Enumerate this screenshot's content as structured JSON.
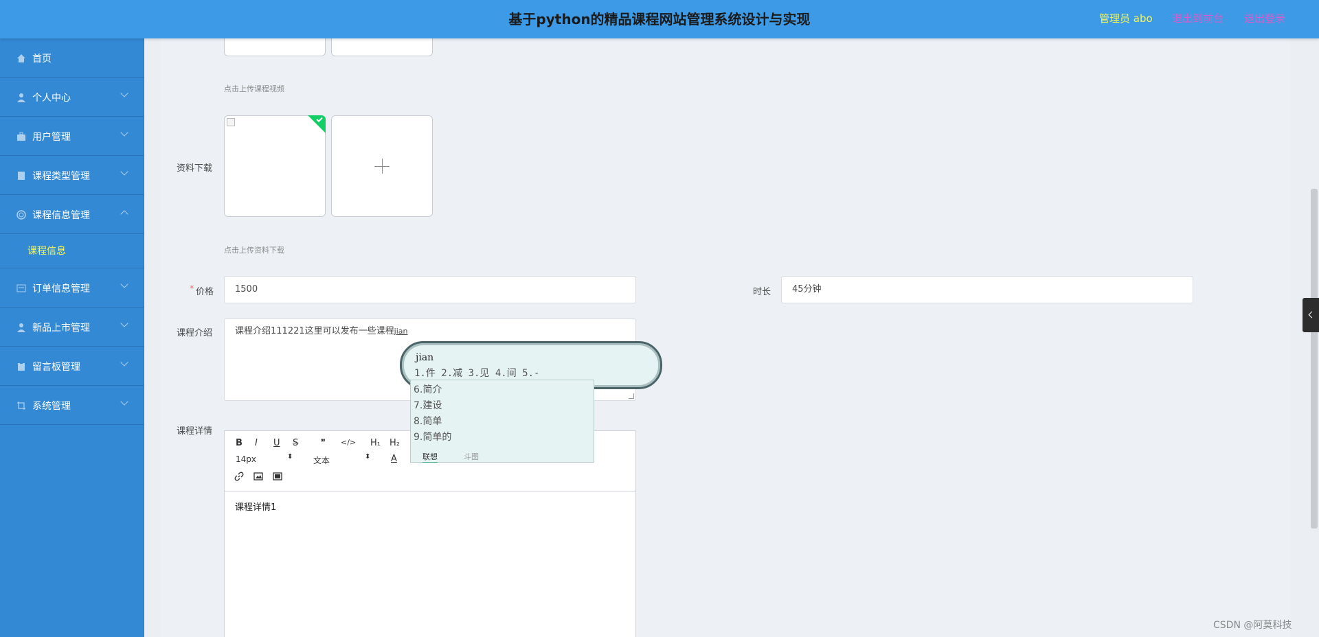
{
  "header": {
    "title": "基于python的精品课程网站管理系统设计与实现",
    "admin": "管理员 abo",
    "to_front": "退出到前台",
    "logout": "退出登录"
  },
  "sidebar": {
    "items": [
      {
        "label": "首页",
        "icon": "home-icon"
      },
      {
        "label": "个人中心",
        "icon": "user-icon"
      },
      {
        "label": "用户管理",
        "icon": "briefcase-icon"
      },
      {
        "label": "课程类型管理",
        "icon": "book-icon"
      },
      {
        "label": "课程信息管理",
        "icon": "circle-icon"
      },
      {
        "label": "订单信息管理",
        "icon": "order-icon"
      },
      {
        "label": "新品上市管理",
        "icon": "user-icon"
      },
      {
        "label": "留言板管理",
        "icon": "clipboard-icon"
      },
      {
        "label": "系统管理",
        "icon": "crop-icon"
      }
    ],
    "sub_item": "课程信息"
  },
  "form": {
    "video_hint": "点击上传课程视频",
    "download_label": "资料下载",
    "download_hint": "点击上传资料下载",
    "price_label": "价格",
    "price_required": "*",
    "price_value": "1500",
    "duration_label": "时长",
    "duration_value": "45分钟",
    "intro_label": "课程介绍",
    "intro_value": "课程介绍111221这里可以发布一些课程",
    "intro_composing": "jian",
    "detail_label": "课程详情",
    "detail_value": "课程详情1"
  },
  "editor": {
    "bold": "B",
    "italic": "I",
    "underline": "U",
    "strike": "S",
    "quote": "❞",
    "code": "</>",
    "h1": "H₁",
    "h2": "H₂",
    "font_size": "14px",
    "font_type": "文本",
    "color": "A"
  },
  "ime": {
    "pinyin": "jian",
    "candidates": "1.件  2.减  3.见  4.间  5.-",
    "list": [
      "6.简介",
      "7.建设",
      "8.简单",
      "9.简单的"
    ],
    "tab_assoc": "联想",
    "tab_meme": "斗图"
  },
  "watermark": "CSDN @阿莫科技"
}
